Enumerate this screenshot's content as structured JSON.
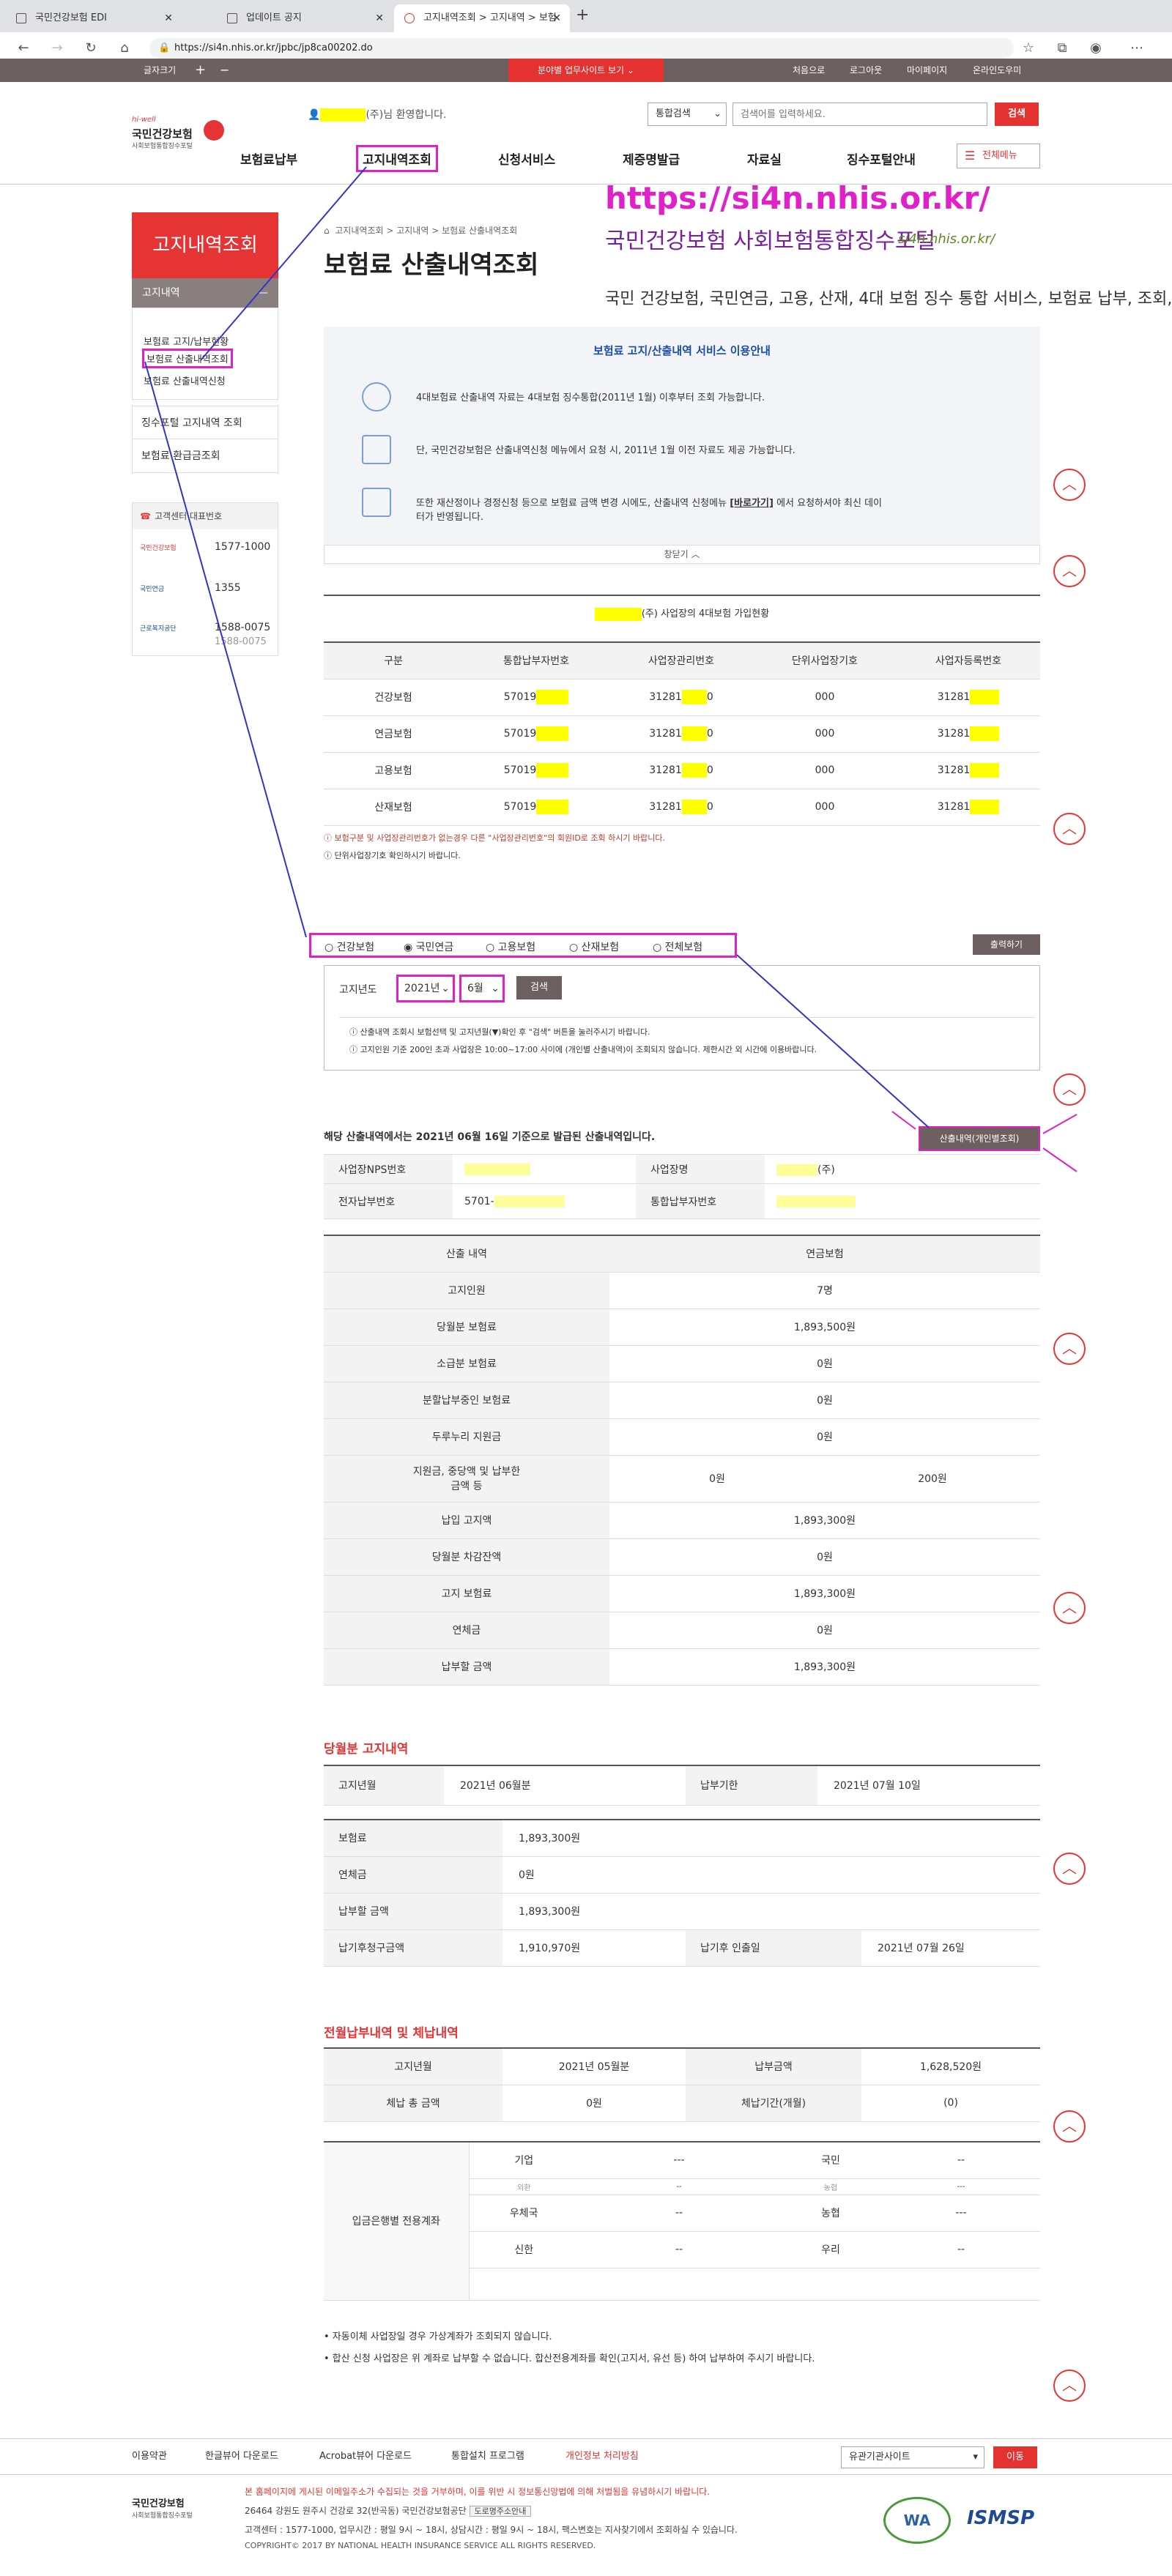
{
  "browser": {
    "tabs": [
      {
        "label": "국민건강보험 EDI"
      },
      {
        "label": "업데이트 공지"
      },
      {
        "label": "고지내역조회 > 고지내역 > 보험"
      }
    ],
    "url": "https://si4n.nhis.or.kr/jpbc/jp8ca00202.do"
  },
  "topbar": {
    "left_label": "글자크기",
    "plus": "+",
    "minus": "−",
    "center_button": "분야별 업무사이트 보기 ⌄",
    "links": [
      "처음으로",
      "로그아웃",
      "마이페이지",
      "온라인도우미"
    ]
  },
  "header": {
    "logo_small": "hi-well",
    "logo_main": "국민건강보험",
    "logo_sub": "사회보험통합징수포털",
    "welcome": "(주)님 환영합니다.",
    "search_select": "통합검색",
    "search_placeholder": "검색어를 입력하세요.",
    "search_button": "검색",
    "gnb": [
      "보험료납부",
      "고지내역조회",
      "신청서비스",
      "제증명발급",
      "자료실",
      "징수포털안내"
    ],
    "all_menu": "전체메뉴"
  },
  "annotation": {
    "url": "https://si4n.nhis.or.kr/",
    "title": "국민건강보험 사회보험통합징수포털",
    "small": "si4n.nhis.or.kr/",
    "desc": "국민 건강보험, 국민연금, 고용, 산재, 4대 보험 징수 통합 서비스, 보험료 납부, 조회, 발급..."
  },
  "sidebar": {
    "title": "고지내역조회",
    "sub": "고지내역",
    "items": [
      "보험료 고지/납부현황",
      "보험료 산출내역조회",
      "보험료 산출내역신청"
    ],
    "boxes": [
      "징수포털 고지내역 조회",
      "보험료 환급금조회"
    ],
    "center_title": "고객센터 대표번호",
    "centers": [
      {
        "name": "국민건강보험",
        "phone": "1577-1000"
      },
      {
        "name": "국민연금",
        "phone": "1355"
      },
      {
        "name": "근로복지공단",
        "phone": "1588-0075"
      },
      {
        "name": "",
        "phone": "1588-0075"
      }
    ]
  },
  "breadcrumb": [
    "고지내역조회",
    "고지내역",
    "보험료 산출내역조회"
  ],
  "page_title": "보험료 산출내역조회",
  "info": {
    "title": "보험료 고지/산출내역 서비스 이용안내",
    "lines": [
      "4대보험료 산출내역 자료는 4대보험 징수통합(2011년 1월) 이후부터 조회 가능합니다.",
      "단, 국민건강보험은 산출내역신청 메뉴에서 요청 시, 2011년 1월 이전 자료도 제공 가능합니다.",
      "또한 재산정이나 경정신청 등으로 보험료 금액 변경 시에도, 산출내역 신청메뉴",
      "에서 요청하셔야 최신 데이",
      "터가 반영됩니다."
    ],
    "link": "[바로가기]",
    "close": "창닫기 ︿"
  },
  "company": {
    "title": "(주) 사업장의 4대보험 가입현황",
    "headers": [
      "구분",
      "통합납부자번호",
      "사업장관리번호",
      "단위사업장기호",
      "사업자등록번호"
    ],
    "rows": [
      [
        "건강보험",
        "57019",
        "31281",
        "000",
        "31281"
      ],
      [
        "연금보험",
        "57019",
        "31281",
        "000",
        "31281"
      ],
      [
        "고용보험",
        "57019",
        "31281",
        "000",
        "31281"
      ],
      [
        "산재보험",
        "57019",
        "31281",
        "000",
        "31281"
      ]
    ],
    "notes": [
      "보험구분 및 사업장관리번호가 없는경우 다른 \"사업장관리번호\"의 회원ID로 조회 하시기 바랍니다.",
      "단위사업장기호 확인하시기 바랍니다."
    ]
  },
  "radios": [
    "건강보험",
    "국민연금",
    "고용보험",
    "산재보험",
    "전체보험"
  ],
  "print_button": "출력하기",
  "search": {
    "label": "고지년도",
    "year": "2021년",
    "month": "6월",
    "button": "검색",
    "notes": [
      "산출내역 조회시 보험선택 및 고지년월(▼)확인 후 \"검색\" 버튼을 눌러주시기 바랍니다.",
      "고지인원 기준 200인 초과 사업장은 10:00~17:00 사이에 (개인별 산출내역)이 조회되지 않습니다. 제한시간 외 시간에 이용바랍니다."
    ]
  },
  "issue_note": "해당 산출내역에서는 2021년 06월 16일 기준으로 발급된 산출내역입니다.",
  "detail_button": "산출내역(개인별조회)",
  "nps": {
    "label1": "사업장NPS번호",
    "label2": "사업장명",
    "value2": "(주)",
    "label3": "전자납부번호",
    "value3": "5701-",
    "label4": "통합납부자번호"
  },
  "calc": {
    "headers": [
      "산출 내역",
      "연금보험"
    ],
    "rows": [
      [
        "고지인원",
        "7명"
      ],
      [
        "당월분 보험료",
        "1,893,500원"
      ],
      [
        "소급분 보험료",
        "0원"
      ],
      [
        "분할납부중인 보험료",
        "0원"
      ],
      [
        "두루누리 지원금",
        "0원"
      ],
      [
        "지원금, 중당액 및 납부한 금액 등",
        "0원",
        "200원"
      ],
      [
        "납입 고지액",
        "1,893,300원"
      ],
      [
        "당월분 차감잔액",
        "0원"
      ],
      [
        "고지 보험료",
        "1,893,300원"
      ],
      [
        "연체금",
        "0원"
      ],
      [
        "납부할 금액",
        "1,893,300원"
      ]
    ]
  },
  "monthly": {
    "title": "당월분 고지내역",
    "r1": [
      "고지년월",
      "2021년 06월분",
      "납부기한",
      "2021년 07월 10일"
    ],
    "rows": [
      [
        "보험료",
        "1,893,300원"
      ],
      [
        "연체금",
        "0원"
      ],
      [
        "납부할 금액",
        "1,893,300원"
      ]
    ],
    "last": [
      "납기후청구금액",
      "1,910,970원",
      "납기후 인출일",
      "2021년 07월 26일"
    ]
  },
  "prev": {
    "title": "전월납부내역 및 체납내역",
    "r1": [
      "고지년월",
      "2021년 05월분",
      "납부금액",
      "1,628,520원"
    ],
    "r2": [
      "체납 총 금액",
      "0원",
      "체납기간(개월)",
      "(0)"
    ],
    "bank_label": "입금은행별 전용계좌",
    "banks": [
      [
        "기업",
        "---",
        "국민",
        "--"
      ],
      [
        "외환",
        "--",
        "농협",
        "---"
      ],
      [
        "우체국",
        "--",
        "농협",
        "---"
      ],
      [
        "신한",
        "--",
        "우리",
        "--"
      ]
    ],
    "notes": [
      "• 자동이체 사업장일 경우 가상계좌가 조회되지 않습니다.",
      "• 합산 신청 사업장은 위 계좌로 납부할 수 없습니다. 합산전용계좌를 확인(고지서, 유선 등) 하여 납부하여 주시기 바랍니다."
    ]
  },
  "footer": {
    "links": [
      "이용약관",
      "한글뷰어 다운로드",
      "Acrobat뷰어 다운로드",
      "통합설치 프로그램",
      "개인정보 처리방침"
    ],
    "select": "유관기관사이트",
    "go": "이동",
    "notice": "본 홈페이지에 게시된 이메일주소가 수집되는 것을 거부하며, 이를 위반 시 정보통신망법에 의해 처벌됨을 유념하시기 바랍니다.",
    "addr": "26464 강원도 원주시 건강로 32(반곡동) 국민건강보험공단",
    "addr_btn": "도로명주소안내",
    "center": "고객센터 : 1577-1000, 업무시간 : 평일 9시 ~ 18시, 상담시간 : 평일 9시 ~ 18시, 팩스변호는 지사찾기에서 조회하실 수 있습니다.",
    "copy": "COPYRIGHT© 2017 BY NATIONAL HEALTH INSURANCE SERVICE ALL RIGHTS RESERVED.",
    "badge1": "WA",
    "badge2": "ISMSP"
  }
}
